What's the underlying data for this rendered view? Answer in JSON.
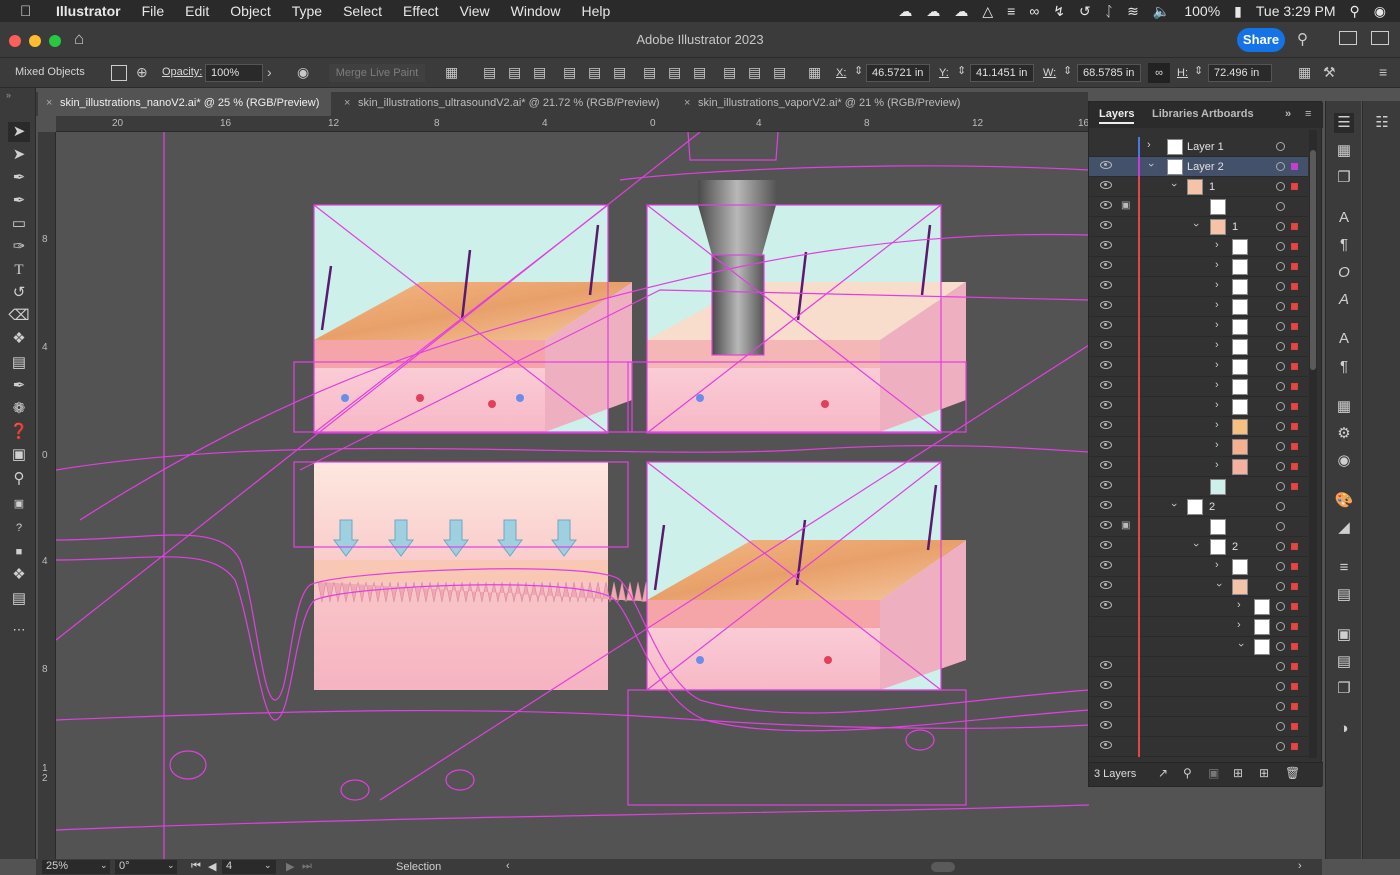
{
  "menubar": {
    "apple": "",
    "items": [
      "Illustrator",
      "File",
      "Edit",
      "Object",
      "Type",
      "Select",
      "Effect",
      "View",
      "Window",
      "Help"
    ],
    "battery": "100%",
    "clock": "Tue 3:29 PM"
  },
  "window": {
    "title": "Adobe Illustrator 2023",
    "share_label": "Share"
  },
  "control": {
    "selection_type": "Mixed Objects",
    "opacity_label": "Opacity:",
    "opacity_value": "100%",
    "merge_live_paint": "Merge Live Paint",
    "x_label": "X:",
    "x_value": "46.5721 in",
    "y_label": "Y:",
    "y_value": "41.1451 in",
    "w_label": "W:",
    "w_value": "68.5785 in",
    "h_label": "H:",
    "h_value": "72.496 in"
  },
  "tabs": [
    {
      "label": "skin_illustrations_nanoV2.ai* @ 25 % (RGB/Preview)"
    },
    {
      "label": "skin_illustrations_ultrasoundV2.ai* @ 21.72 % (RGB/Preview)"
    },
    {
      "label": "skin_illustrations_vaporV2.ai* @ 21 % (RGB/Preview)"
    }
  ],
  "rulers": {
    "h": [
      "20",
      "16",
      "12",
      "8",
      "4",
      "0",
      "4",
      "8",
      "12",
      "16"
    ],
    "v": [
      "8",
      "4",
      "0",
      "4",
      "8",
      "1\n2"
    ]
  },
  "layers_panel": {
    "tabs": [
      "Layers",
      "Libraries",
      "Artboards"
    ],
    "layer1": "Layer 1",
    "layer2": "Layer 2",
    "sub1": "1",
    "sub1_1": "1",
    "sub2": "2",
    "sub2_2": "2",
    "footer": "3 Layers"
  },
  "status": {
    "zoom": "25%",
    "rotation": "0°",
    "artboard": "4",
    "tool": "Selection"
  },
  "colors": {
    "accent": "#1473e6",
    "selection": "#e040e0",
    "layer_red": "#e04848",
    "layer_blue": "#4a78e0"
  },
  "icons": [
    "selection-tool-icon",
    "direct-selection-icon",
    "pen-icon",
    "curvature-icon",
    "rectangle-icon",
    "paintbrush-icon",
    "type-icon",
    "rotate-icon",
    "eraser-icon",
    "width-icon",
    "gradient-icon",
    "eyedropper-icon",
    "blend-icon",
    "shape-builder-icon",
    "artboard-icon",
    "zoom-icon",
    "more-tools-icon"
  ]
}
